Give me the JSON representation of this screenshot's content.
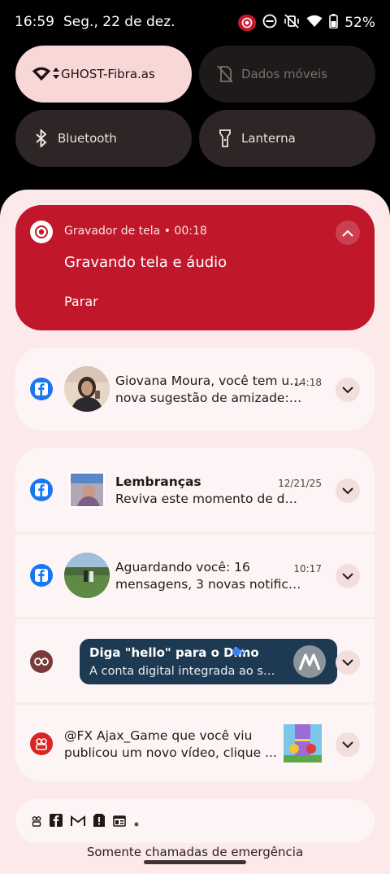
{
  "status_bar": {
    "time": "16:59",
    "date": "Seg., 22 de dez.",
    "battery": "52%",
    "icons": [
      "screen-record-icon",
      "do-not-disturb-icon",
      "vibrate-off-icon",
      "wifi-icon",
      "battery-icon"
    ]
  },
  "quick_settings": {
    "wifi": {
      "label": "GHOST-Fibra.as",
      "icon": "wifi-icon",
      "state": "on"
    },
    "mobile_data": {
      "label": "Dados móveis",
      "icon": "no-sim-icon",
      "state": "unavailable"
    },
    "bluetooth": {
      "label": "Bluetooth",
      "icon": "bluetooth-icon",
      "state": "off"
    },
    "flashlight": {
      "label": "Lanterna",
      "icon": "flashlight-icon",
      "state": "off"
    }
  },
  "recorder": {
    "app": "Gravador de tela",
    "separator": "•",
    "elapsed": "00:18",
    "title": "Gravando tela e áudio",
    "action": "Parar",
    "color": "#c0172b"
  },
  "notifications": [
    {
      "app_icon": "facebook-icon",
      "text1": "Giovana Moura, você tem uma",
      "text2": "nova sugestão de amizade: I...",
      "time": "14:18"
    },
    {
      "app_icon": "facebook-icon",
      "title": "Lembranças",
      "text2": "Reviva este momento de dezem...",
      "time": "12/21/25"
    },
    {
      "app_icon": "facebook-icon",
      "text1": "Aguardando você: 16",
      "text2": "mensagens, 3 novas notifica...",
      "time": "10:17"
    },
    {
      "app_icon": "motorola-icon",
      "promo_title": "Diga \"hello\" para o Dimo",
      "promo_body": "A conta digital integrada ao sm..."
    },
    {
      "app_icon": "youtube-creator-icon",
      "text1": "@FX Ajax_Game que você viu",
      "text2": "publicou um novo vídeo, clique ..."
    }
  ],
  "footer": {
    "mini_icons": [
      "threads-icon",
      "facebook-icon",
      "gmail-icon",
      "alert-icon",
      "news-icon",
      "more-dot-icon"
    ],
    "emergency": "Somente chamadas de emergência"
  },
  "colors": {
    "tile_active": "#f8d7d7",
    "shade_bg": "#fce9e9",
    "facebook_blue": "#1877f2"
  }
}
